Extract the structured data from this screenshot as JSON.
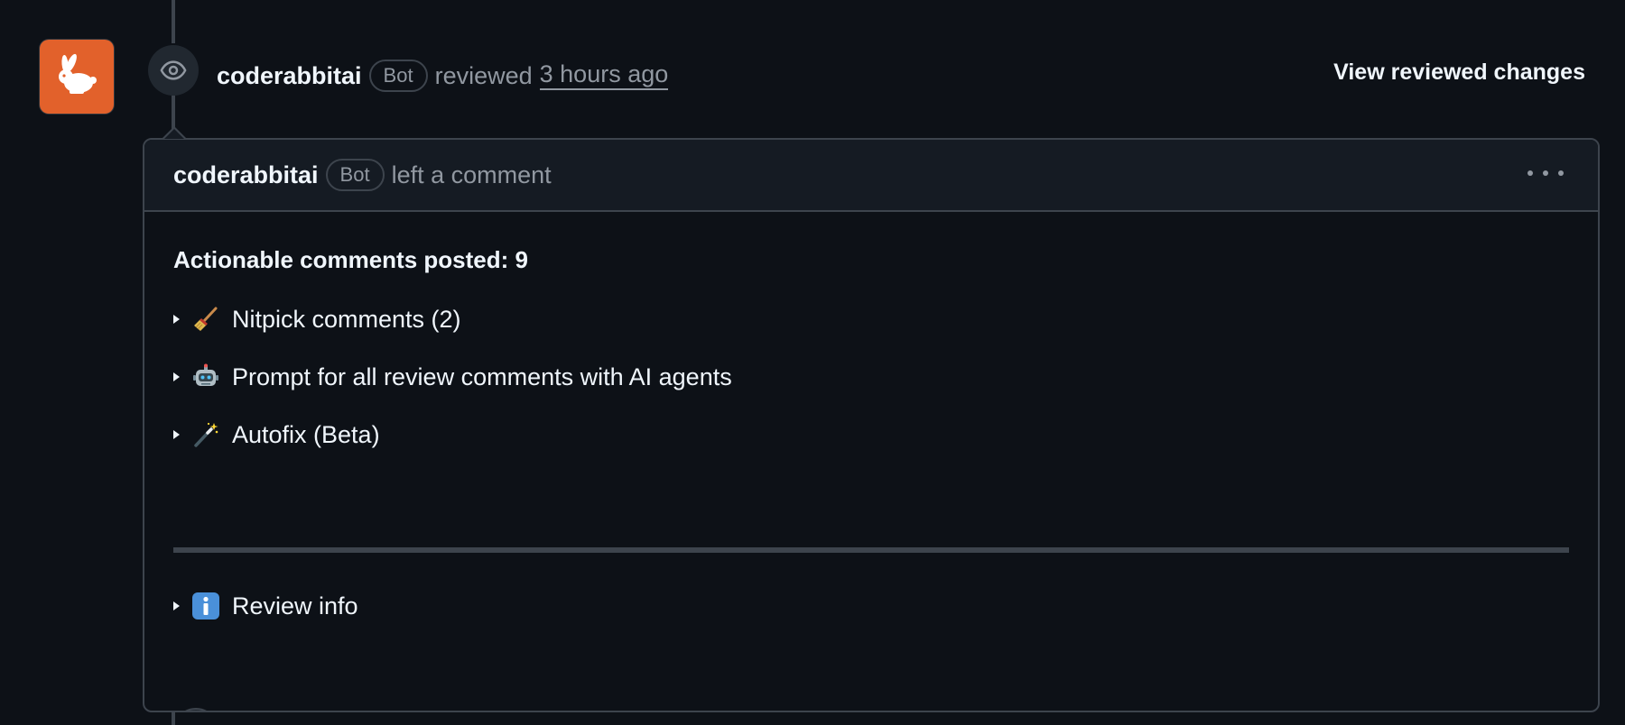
{
  "review": {
    "author": "coderabbitai",
    "badge": "Bot",
    "action": "reviewed",
    "time": "3 hours ago",
    "view_changes_label": "View reviewed changes",
    "avatar_icon": "rabbit-icon",
    "event_icon": "eye-icon"
  },
  "comment": {
    "author": "coderabbitai",
    "badge": "Bot",
    "action": "left a comment",
    "menu_icon": "kebab-horizontal-icon",
    "title": "Actionable comments posted: 9",
    "details": [
      {
        "icon": "broom-icon",
        "label": "Nitpick comments (2)"
      },
      {
        "icon": "robot-icon",
        "label": "Prompt for all review comments with AI agents"
      },
      {
        "icon": "magic-wand-icon",
        "label": "Autofix (Beta)"
      },
      {
        "icon": "information-icon",
        "label": "Review info"
      }
    ],
    "reaction_icon": "smiley-icon"
  },
  "colors": {
    "background": "#0d1117",
    "header_bg": "#151b23",
    "border": "#3d444d",
    "muted_text": "#9198a1",
    "avatar_bg": "#e2612b"
  }
}
